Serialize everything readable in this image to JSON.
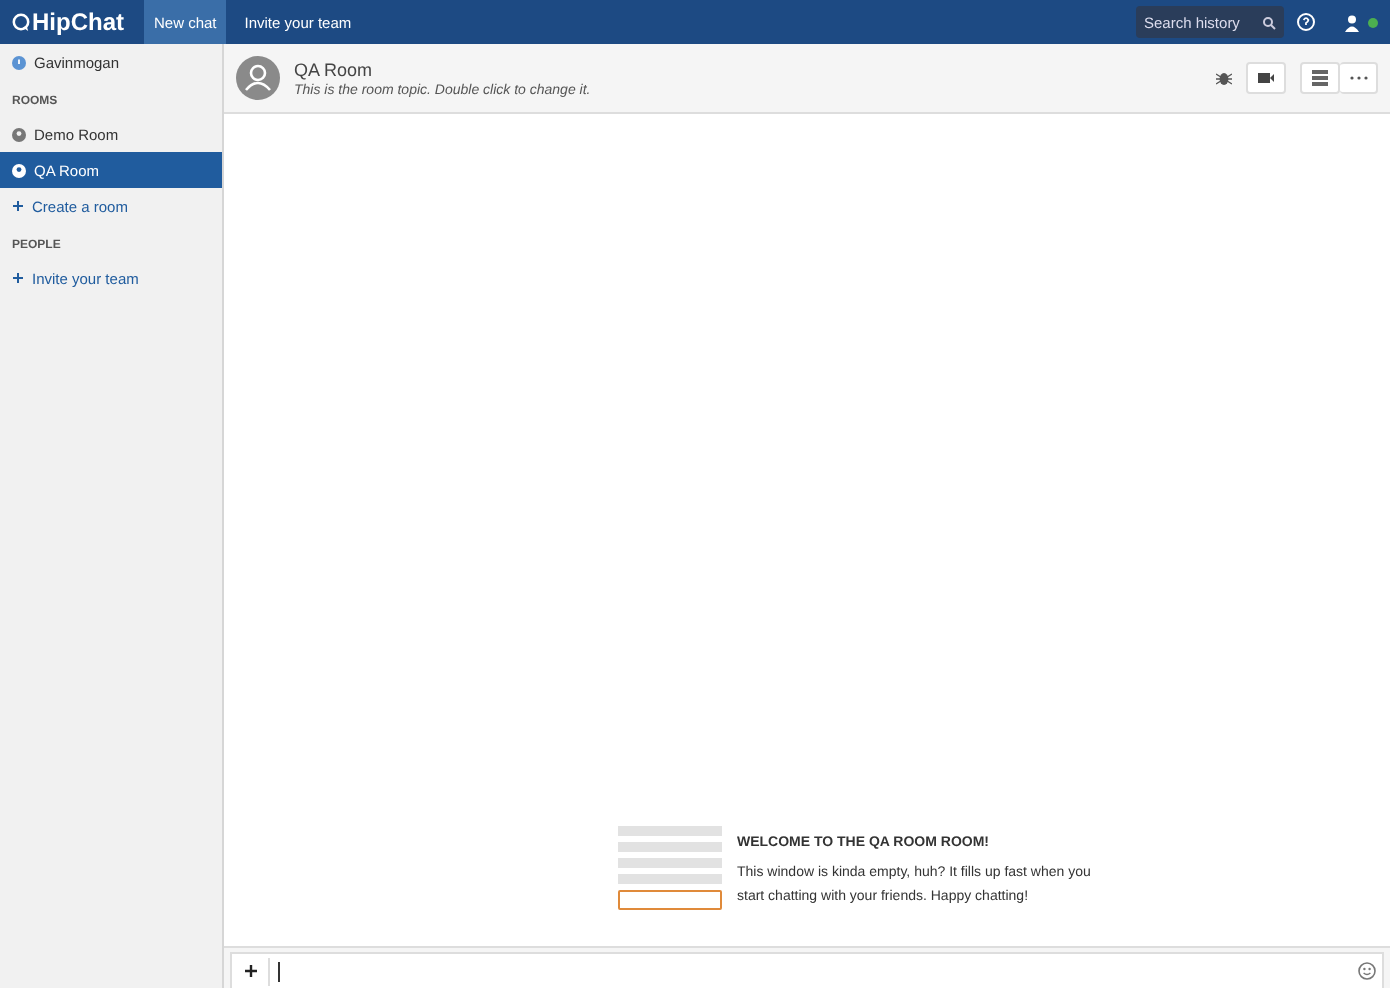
{
  "topbar": {
    "logo": "HipChat",
    "nav": [
      {
        "label": "New chat",
        "selected": true
      },
      {
        "label": "Invite your team",
        "selected": false
      }
    ],
    "search": {
      "placeholder": "Search history"
    }
  },
  "sidebar": {
    "user": "Gavinmogan",
    "sections": [
      {
        "title": "ROOMS",
        "items": [
          {
            "kind": "room",
            "label": "Demo Room",
            "selected": false
          },
          {
            "kind": "room",
            "label": "QA Room",
            "selected": true
          },
          {
            "kind": "action",
            "label": "Create a room",
            "selected": false
          }
        ]
      },
      {
        "title": "PEOPLE",
        "items": [
          {
            "kind": "action",
            "label": "Invite your team",
            "selected": false
          }
        ]
      }
    ]
  },
  "room": {
    "name": "QA Room",
    "topic": "This is the room topic. Double click to change it."
  },
  "welcome": {
    "title": "WELCOME TO THE QA ROOM ROOM!",
    "text": "This window is kinda empty, huh? It fills up fast when you start chatting with your friends. Happy chatting!"
  }
}
